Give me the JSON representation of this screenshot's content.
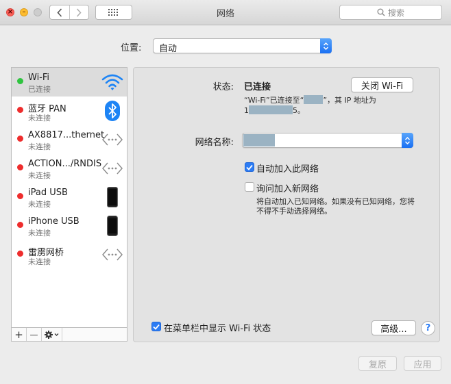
{
  "window": {
    "title": "网络",
    "search_placeholder": "搜索"
  },
  "location": {
    "label": "位置:",
    "value": "自动"
  },
  "services": [
    {
      "name": "Wi-Fi",
      "status": "已连接",
      "state_color": "#2fc43f",
      "icon": "wifi-icon"
    },
    {
      "name": "蓝牙 PAN",
      "status": "未连接",
      "state_color": "#ee2d2d",
      "icon": "bluetooth-icon"
    },
    {
      "name": "AX8817...thernet",
      "status": "未连接",
      "state_color": "#ee2d2d",
      "icon": "ethernet-icon"
    },
    {
      "name": "ACTION.../RNDIS",
      "status": "未连接",
      "state_color": "#ee2d2d",
      "icon": "ethernet-icon"
    },
    {
      "name": "iPad USB",
      "status": "未连接",
      "state_color": "#ee2d2d",
      "icon": "ipad-icon"
    },
    {
      "name": "iPhone USB",
      "status": "未连接",
      "state_color": "#ee2d2d",
      "icon": "iphone-icon"
    },
    {
      "name": "雷雳网桥",
      "status": "未连接",
      "state_color": "#ee2d2d",
      "icon": "ethernet-icon"
    }
  ],
  "list_tools": {
    "add": "+",
    "remove": "—"
  },
  "detail": {
    "status_label": "状态:",
    "status_value": "已连接",
    "turn_off_button": "关闭 Wi-Fi",
    "connection_desc_part1": "“Wi-Fi”已连接至“",
    "connection_desc_part2": "”，其 IP 地址为",
    "connection_desc_part3": "1",
    "connection_desc_part4": "5。",
    "network_name_label": "网络名称:",
    "auto_join_label": "自动加入此网络",
    "auto_join_checked": true,
    "ask_join_label": "询问加入新网络",
    "ask_join_checked": false,
    "ask_join_help": "将自动加入已知网络。如果没有已知网络，您将不得不手动选择网络。",
    "show_menubar_label": "在菜单栏中显示 Wi-Fi 状态",
    "show_menubar_checked": true,
    "advanced_button": "高级...",
    "help_button": "?"
  },
  "footer": {
    "revert_button": "复原",
    "apply_button": "应用"
  },
  "colors": {
    "accent": "#2c7cf4",
    "connected": "#2fc43f",
    "disconnected": "#ee2d2d"
  }
}
